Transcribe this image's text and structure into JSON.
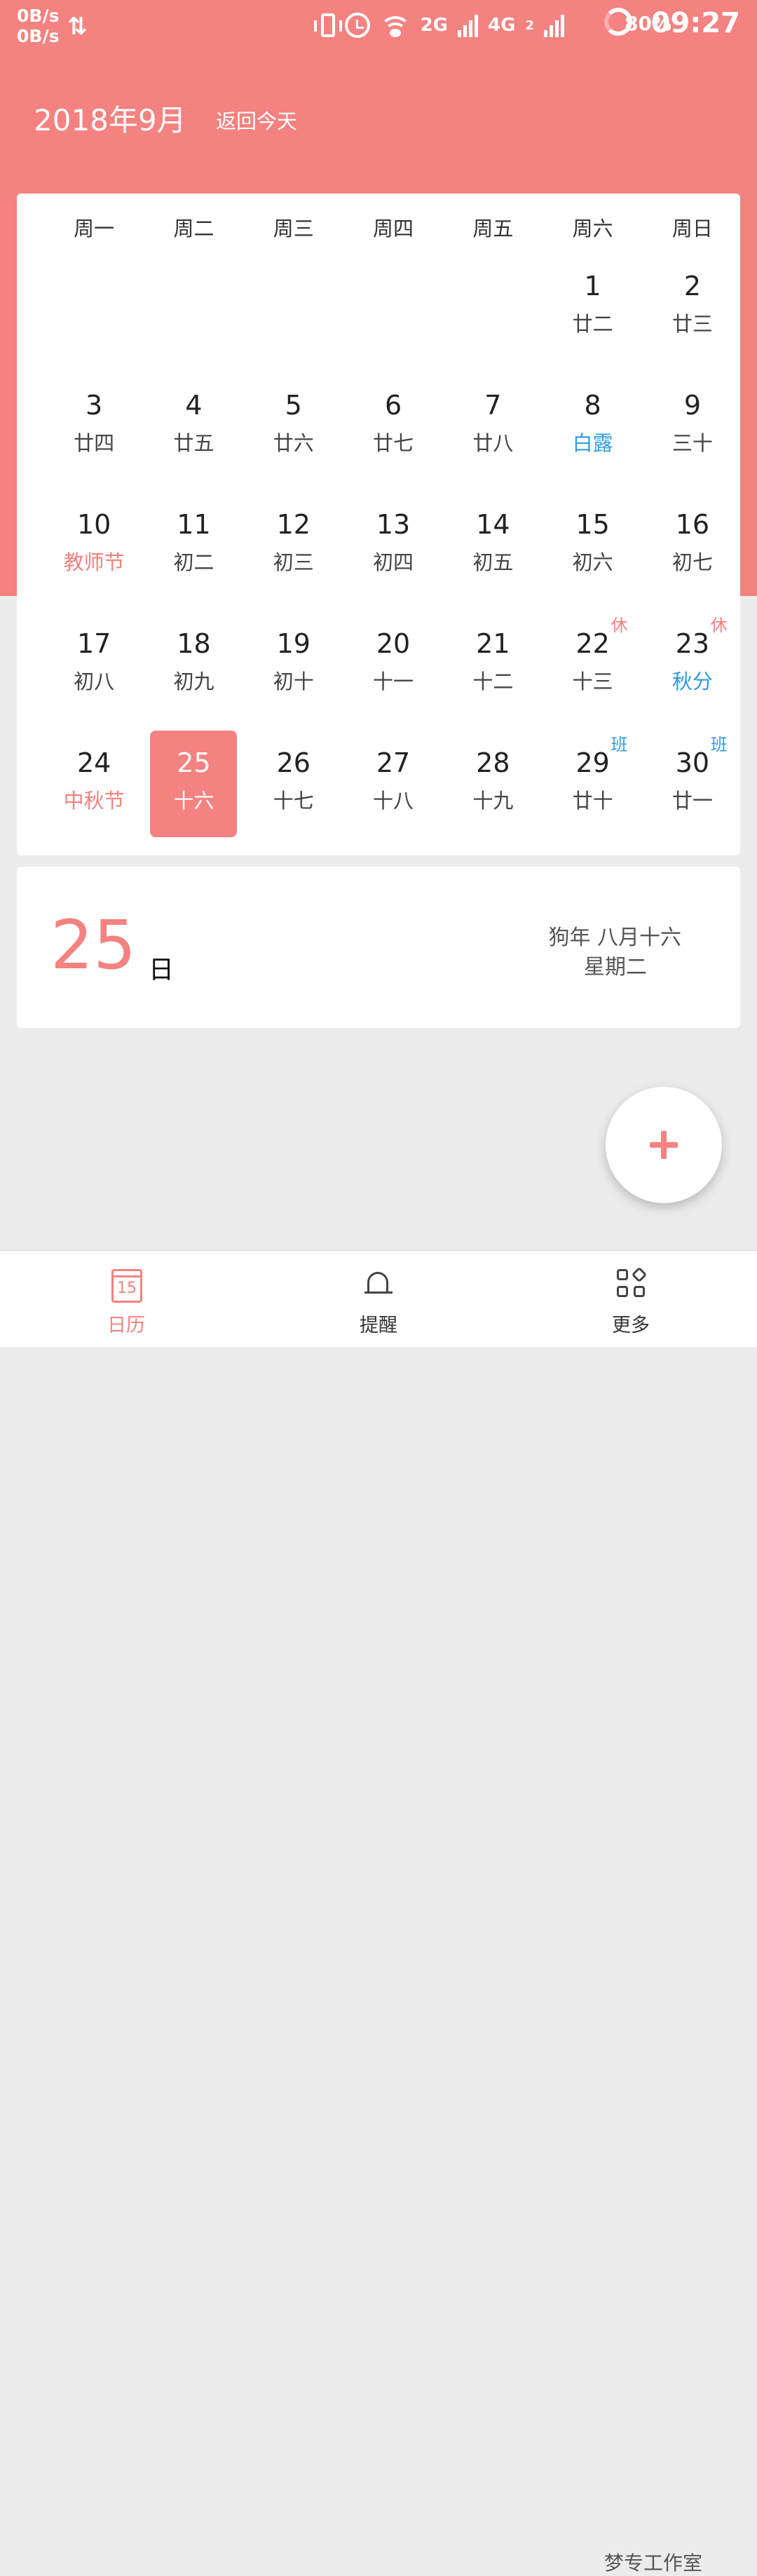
{
  "status_bar": {
    "speed_up": "0B/s",
    "speed_down": "0B/s",
    "net2": "2G",
    "net4": "4G",
    "sim2": "2",
    "battery": "80%",
    "time": "09:27"
  },
  "header": {
    "month_title": "2018年9月",
    "back_today": "返回今天"
  },
  "calendar": {
    "weekdays": [
      "周一",
      "周二",
      "周三",
      "周四",
      "周五",
      "周六",
      "周日"
    ],
    "days": [
      {
        "d": "",
        "l": ""
      },
      {
        "d": "",
        "l": ""
      },
      {
        "d": "",
        "l": ""
      },
      {
        "d": "",
        "l": ""
      },
      {
        "d": "",
        "l": ""
      },
      {
        "d": "1",
        "l": "廿二"
      },
      {
        "d": "2",
        "l": "廿三"
      },
      {
        "d": "3",
        "l": "廿四"
      },
      {
        "d": "4",
        "l": "廿五"
      },
      {
        "d": "5",
        "l": "廿六"
      },
      {
        "d": "6",
        "l": "廿七"
      },
      {
        "d": "7",
        "l": "廿八"
      },
      {
        "d": "8",
        "l": "白露",
        "lc": "blue"
      },
      {
        "d": "9",
        "l": "三十"
      },
      {
        "d": "10",
        "l": "教师节",
        "lc": "red"
      },
      {
        "d": "11",
        "l": "初二"
      },
      {
        "d": "12",
        "l": "初三"
      },
      {
        "d": "13",
        "l": "初四"
      },
      {
        "d": "14",
        "l": "初五"
      },
      {
        "d": "15",
        "l": "初六"
      },
      {
        "d": "16",
        "l": "初七"
      },
      {
        "d": "17",
        "l": "初八"
      },
      {
        "d": "18",
        "l": "初九"
      },
      {
        "d": "19",
        "l": "初十"
      },
      {
        "d": "20",
        "l": "十一"
      },
      {
        "d": "21",
        "l": "十二"
      },
      {
        "d": "22",
        "l": "十三",
        "badge": "休",
        "bt": "rest"
      },
      {
        "d": "23",
        "l": "秋分",
        "lc": "blue",
        "badge": "休",
        "bt": "rest"
      },
      {
        "d": "24",
        "l": "中秋节",
        "lc": "red"
      },
      {
        "d": "25",
        "l": "十六",
        "selected": true
      },
      {
        "d": "26",
        "l": "十七"
      },
      {
        "d": "27",
        "l": "十八"
      },
      {
        "d": "28",
        "l": "十九"
      },
      {
        "d": "29",
        "l": "廿十",
        "badge": "班",
        "bt": "work"
      },
      {
        "d": "30",
        "l": "廿一",
        "badge": "班",
        "bt": "work"
      }
    ]
  },
  "detail": {
    "day": "25",
    "day_unit": "日",
    "lunar_year": "狗年 八月十六",
    "weekday_name": "星期二"
  },
  "bottom_nav": {
    "items": [
      {
        "label": "日历",
        "icon": "calendar-icon",
        "icon_num": "15",
        "active": true
      },
      {
        "label": "提醒",
        "icon": "bell-icon"
      },
      {
        "label": "更多",
        "icon": "apps-icon"
      }
    ],
    "watermark": "梦专工作室"
  },
  "colors": {
    "accent": "#F38280",
    "holiday_blue": "#2F9BE0",
    "background": "#ECECEC"
  }
}
